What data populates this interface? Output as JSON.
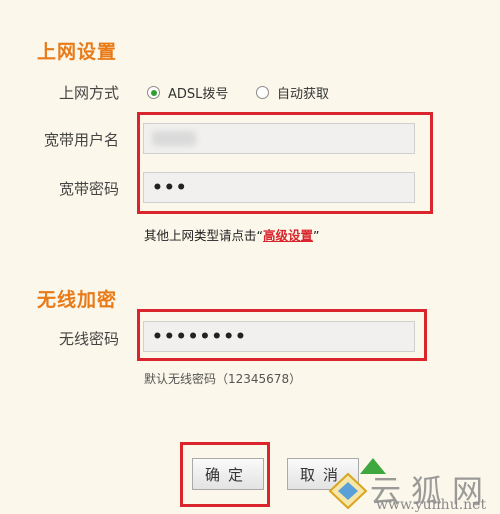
{
  "internet": {
    "title": "上网设置",
    "mode_label": "上网方式",
    "mode_options": [
      {
        "label": "ADSL拨号",
        "checked": true
      },
      {
        "label": "自动获取",
        "checked": false
      }
    ],
    "username_label": "宽带用户名",
    "username_value": "",
    "password_label": "宽带密码",
    "password_value": "•••",
    "hint_prefix": "其他上网类型请点击“",
    "hint_link": "高级设置",
    "hint_suffix": "”"
  },
  "wireless": {
    "title": "无线加密",
    "password_label": "无线密码",
    "password_value": "••••••••",
    "default_note": "默认无线密码（12345678）"
  },
  "buttons": {
    "confirm": "确定",
    "cancel": "取消"
  },
  "watermark": {
    "text": "云狐网",
    "url": "www.yunhu.net"
  },
  "colors": {
    "section_title": "#e87a18",
    "highlight": "#d9252b",
    "background": "#fbf7ea"
  }
}
